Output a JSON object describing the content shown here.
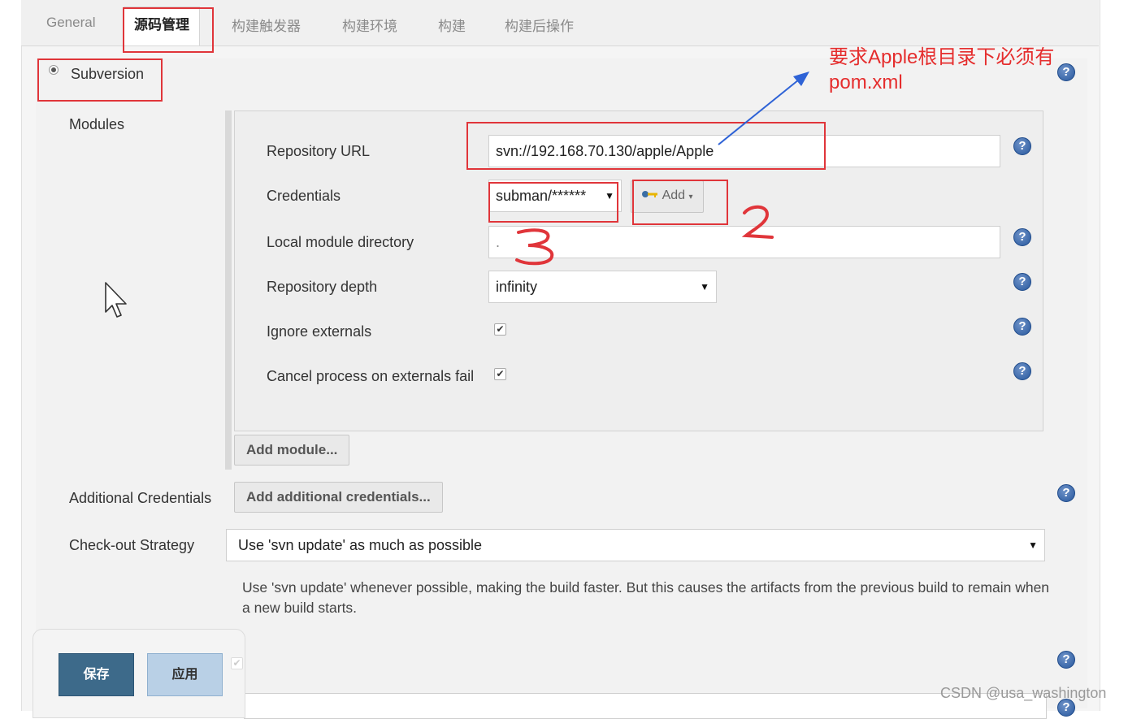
{
  "tabs": [
    {
      "label": "General"
    },
    {
      "label": "源码管理"
    },
    {
      "label": "构建触发器"
    },
    {
      "label": "构建环境"
    },
    {
      "label": "构建"
    },
    {
      "label": "构建后操作"
    }
  ],
  "scm": {
    "option_label": "Subversion",
    "modules_label": "Modules",
    "repo_url_label": "Repository URL",
    "repo_url_value": "svn://192.168.70.130/apple/Apple",
    "credentials_label": "Credentials",
    "credentials_value": "subman/******",
    "add_label": "Add",
    "local_dir_label": "Local module directory",
    "local_dir_value": ".",
    "depth_label": "Repository depth",
    "depth_value": "infinity",
    "ignore_label": "Ignore externals",
    "cancel_label": "Cancel process on externals fail",
    "add_module_label": "Add module...",
    "additional_label": "Additional Credentials",
    "add_additional_label": "Add additional credentials...",
    "strategy_label": "Check-out Strategy",
    "strategy_value": "Use 'svn update' as much as possible",
    "strategy_desc": "Use 'svn update' whenever possible, making the build faster. But this causes the artifacts from the previous build to remain when a new build starts."
  },
  "footer": {
    "save_label": "保存",
    "apply_label": "应用"
  },
  "annotations": {
    "note_line1": "要求Apple根目录下必须有",
    "note_line2": "pom.xml",
    "mark_2": "2",
    "mark_3": "3"
  },
  "help_icon_text": "?",
  "watermark": "CSDN @usa_washington",
  "colors": {
    "annotation_red": "#e0353a",
    "arrow_blue": "#2f63d6",
    "help_blue": "#28589d",
    "save_button": "#3d6a8a"
  }
}
